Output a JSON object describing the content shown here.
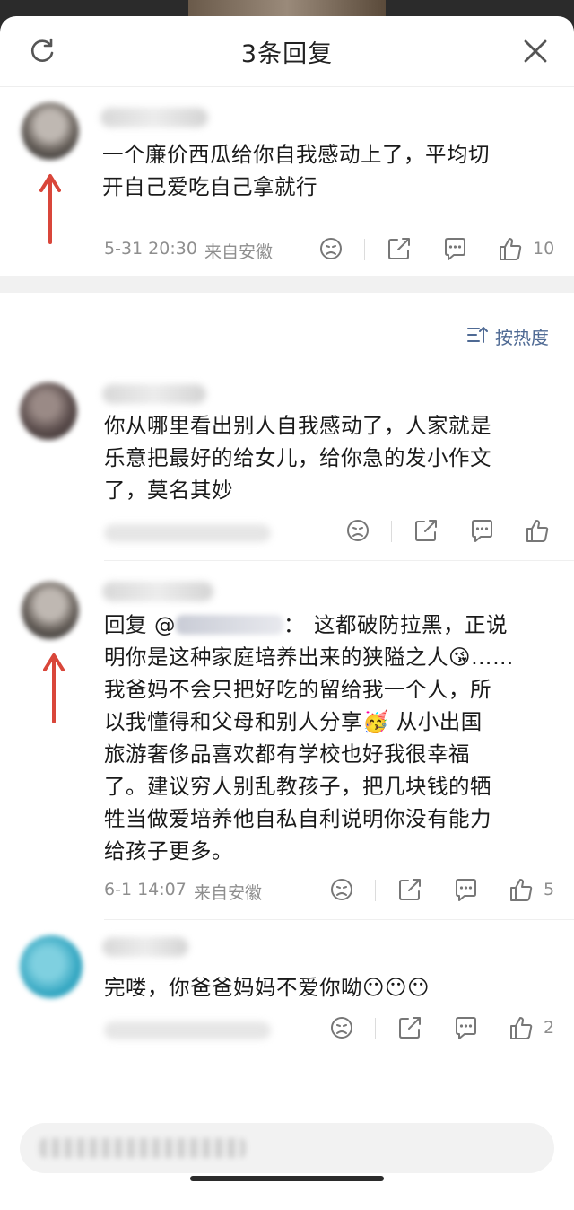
{
  "header": {
    "title": "3条回复"
  },
  "root_comment": {
    "text_line1": "一个廉价西瓜给你自我感动上了，平均切",
    "text_line2": "开自己爱吃自己拿就行",
    "time": "5-31 20:30",
    "location": "来自安徽",
    "like_count": "10"
  },
  "sort": {
    "label": "按热度"
  },
  "replies": [
    {
      "line1": "你从哪里看出别人自我感动了，人家就是",
      "line2": "乐意把最好的给女儿，给你急的发小作文",
      "line3": "了，莫名其妙"
    },
    {
      "prefix": "回复 @",
      "colon": "：",
      "line1_rest": "这都破防拉黑，正说",
      "line2": "明你是这种家庭培养出来的狭隘之人😘……",
      "line3": "我爸妈不会只把好吃的留给我一个人，所",
      "line4": "以我懂得和父母和别人分享🥳 从小出国",
      "line5": "旅游奢侈品喜欢都有学校也好我很幸福",
      "line6": "了。建议穷人别乱教孩子，把几块钱的牺",
      "line7": "牲当做爱培养他自私自利说明你没有能力",
      "line8": "给孩子更多。",
      "time": "6-1 14:07",
      "location": "来自安徽",
      "like_count": "5"
    },
    {
      "line1": "完喽，你爸爸妈妈不爱你呦😶😶😶",
      "like_count": "2"
    }
  ],
  "colors": {
    "accent": "#4f6a94",
    "arrow": "#d9463a",
    "meta": "#8e8e8e"
  },
  "icons": [
    "refresh-icon",
    "close-icon",
    "dislike-icon",
    "share-icon",
    "comment-icon",
    "like-icon",
    "sort-icon",
    "red-arrow-annotation"
  ]
}
